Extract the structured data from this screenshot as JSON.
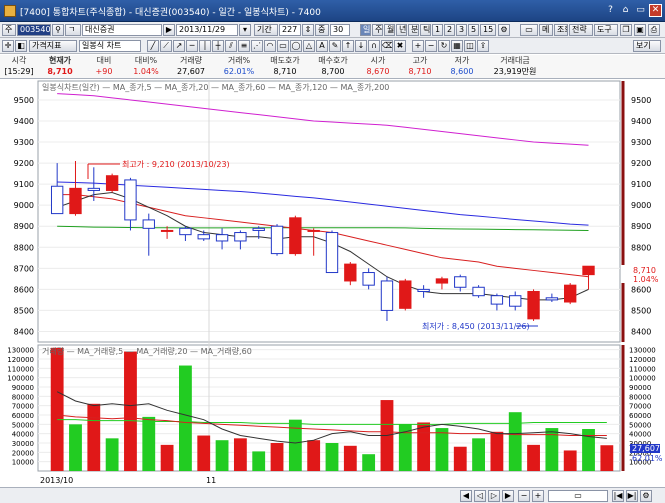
{
  "window": {
    "title": "[7400] 통합차트(주식종합) - 대신증권(003540) - 일간 - 일봉식차트) - 7400",
    "buttons": [
      "?",
      "⌂",
      "▭",
      "✕"
    ]
  },
  "toolbar1": {
    "code_prefix": "주",
    "stock_code": "003540",
    "market_box": "ㄱ",
    "stock_name": "대신증권",
    "date": "2013/11/29",
    "period_label": "기간",
    "period_value": "227",
    "zoom_label": "중",
    "zoom_value": "30",
    "periods": [
      "일",
      "주",
      "월",
      "년",
      "분",
      "틱",
      "1",
      "2",
      "3",
      "5",
      "15"
    ],
    "right_buttons": [
      "메",
      "조회",
      "전략",
      "도구"
    ]
  },
  "toolbar2": {
    "left_buttons": [
      "가격지표",
      "일봉식 차트"
    ],
    "view_button": "보기"
  },
  "info": {
    "headers": [
      "시각",
      "현재가",
      "대비",
      "대비%",
      "거래량",
      "거래%",
      "매도호가",
      "매수호가",
      "시가",
      "고가",
      "저가",
      "거래대금"
    ],
    "values": [
      "[15:29]",
      "8,710",
      "+90",
      "1.04%",
      "27,607",
      "62.01%",
      "8,710",
      "8,700",
      "8,670",
      "8,710",
      "8,600",
      "23,919만원"
    ]
  },
  "price_legend": "일봉식차트(일간) — MA_종가,5 — MA_종가,20 — MA_종가,60 — MA_종가,120 — MA_종가,200",
  "volume_legend": "거래량 — MA_거래량,5 — MA_거래량,20 — MA_거래량,60",
  "annotations": {
    "high": "최고가 : 9,210 (2013/10/23)",
    "low": "최저가 : 8,450 (2013/11/26)"
  },
  "current_tag": {
    "price": "8,710",
    "pct": "1.04%"
  },
  "volume_tag": {
    "vol": "27,607",
    "pct": "62.01%"
  },
  "x_labels": [
    "2013/10",
    "11"
  ],
  "colors": {
    "up": "#e01818",
    "down": "#2238c8",
    "ma5": "#333333",
    "ma20": "#d82020",
    "ma60": "#2a2ae0",
    "ma120": "#20a020",
    "ma200": "#d020d0",
    "volume_green": "#22cc22"
  },
  "chart_data": {
    "type": "candlestick",
    "title": "",
    "price_ylim": [
      8350,
      9590
    ],
    "price_ticks": [
      8400,
      8500,
      8600,
      8700,
      8800,
      8900,
      9000,
      9100,
      9200,
      9300,
      9400,
      9500
    ],
    "volume_ylim": [
      0,
      135000
    ],
    "volume_ticks": [
      10000,
      20000,
      30000,
      40000,
      50000,
      60000,
      70000,
      80000,
      90000,
      100000,
      110000,
      120000,
      130000
    ],
    "candles": [
      {
        "o": 9090,
        "h": 9200,
        "l": 8960,
        "c": 8960
      },
      {
        "o": 8960,
        "h": 9210,
        "l": 8950,
        "c": 9080
      },
      {
        "o": 9080,
        "h": 9180,
        "l": 9020,
        "c": 9070
      },
      {
        "o": 9070,
        "h": 9150,
        "l": 9060,
        "c": 9140
      },
      {
        "o": 9120,
        "h": 9130,
        "l": 8880,
        "c": 8930
      },
      {
        "o": 8930,
        "h": 8960,
        "l": 8760,
        "c": 8890
      },
      {
        "o": 8880,
        "h": 8900,
        "l": 8840,
        "c": 8880
      },
      {
        "o": 8890,
        "h": 8900,
        "l": 8830,
        "c": 8860
      },
      {
        "o": 8860,
        "h": 8880,
        "l": 8830,
        "c": 8840
      },
      {
        "o": 8860,
        "h": 8890,
        "l": 8790,
        "c": 8830
      },
      {
        "o": 8870,
        "h": 8880,
        "l": 8790,
        "c": 8830
      },
      {
        "o": 8890,
        "h": 8900,
        "l": 8840,
        "c": 8880
      },
      {
        "o": 8900,
        "h": 8910,
        "l": 8760,
        "c": 8770
      },
      {
        "o": 8770,
        "h": 8950,
        "l": 8760,
        "c": 8940
      },
      {
        "o": 8880,
        "h": 8890,
        "l": 8760,
        "c": 8880
      },
      {
        "o": 8870,
        "h": 8880,
        "l": 8680,
        "c": 8680
      },
      {
        "o": 8640,
        "h": 8730,
        "l": 8620,
        "c": 8720
      },
      {
        "o": 8680,
        "h": 8700,
        "l": 8600,
        "c": 8620
      },
      {
        "o": 8640,
        "h": 8660,
        "l": 8450,
        "c": 8500
      },
      {
        "o": 8510,
        "h": 8650,
        "l": 8500,
        "c": 8640
      },
      {
        "o": 8600,
        "h": 8620,
        "l": 8560,
        "c": 8590
      },
      {
        "o": 8630,
        "h": 8660,
        "l": 8600,
        "c": 8650
      },
      {
        "o": 8660,
        "h": 8670,
        "l": 8590,
        "c": 8610
      },
      {
        "o": 8610,
        "h": 8620,
        "l": 8560,
        "c": 8570
      },
      {
        "o": 8570,
        "h": 8580,
        "l": 8500,
        "c": 8530
      },
      {
        "o": 8570,
        "h": 8590,
        "l": 8500,
        "c": 8520
      },
      {
        "o": 8460,
        "h": 8600,
        "l": 8450,
        "c": 8590
      },
      {
        "o": 8560,
        "h": 8580,
        "l": 8540,
        "c": 8550
      },
      {
        "o": 8540,
        "h": 8630,
        "l": 8530,
        "c": 8620
      },
      {
        "o": 8670,
        "h": 8710,
        "l": 8600,
        "c": 8710
      }
    ],
    "ma5": [
      8990,
      9020,
      9050,
      9060,
      9030,
      8990,
      8950,
      8900,
      8870,
      8860,
      8850,
      8850,
      8840,
      8850,
      8850,
      8820,
      8780,
      8720,
      8660,
      8620,
      8590,
      8580,
      8580,
      8580,
      8570,
      8560,
      8550,
      8550,
      8560,
      8600
    ],
    "ma20": [
      9050,
      9050,
      9040,
      9030,
      9010,
      8990,
      8970,
      8950,
      8940,
      8930,
      8920,
      8910,
      8900,
      8890,
      8880,
      8870,
      8850,
      8830,
      8810,
      8790,
      8770,
      8750,
      8740,
      8730,
      8710,
      8700,
      8690,
      8680,
      8670,
      8660
    ],
    "ma60": [
      9110,
      9108,
      9105,
      9100,
      9095,
      9090,
      9085,
      9080,
      9075,
      9070,
      9065,
      9058,
      9050,
      9042,
      9035,
      9025,
      9015,
      9005,
      8995,
      8985,
      8975,
      8965,
      8955,
      8948,
      8940,
      8932,
      8925,
      8918,
      8910,
      8905
    ],
    "ma120": [
      8900,
      8898,
      8896,
      8895,
      8894,
      8893,
      8893,
      8892,
      8892,
      8892,
      8893,
      8893,
      8893,
      8893,
      8893,
      8893,
      8893,
      8893,
      8893,
      8892,
      8890,
      8888,
      8887,
      8886,
      8885,
      8884,
      8883,
      8882,
      8881,
      8880
    ],
    "ma200": [
      9530,
      9525,
      9520,
      9510,
      9500,
      9490,
      9480,
      9470,
      9460,
      9450,
      9440,
      9430,
      9420,
      9410,
      9400,
      9395,
      9390,
      9385,
      9380,
      9370,
      9360,
      9350,
      9340,
      9330,
      9320,
      9310,
      9300,
      9295,
      9290,
      9285
    ],
    "volume": [
      132000,
      50000,
      72000,
      35000,
      128000,
      58000,
      28000,
      113000,
      38000,
      33000,
      35000,
      21000,
      30000,
      55000,
      33000,
      30000,
      27000,
      18000,
      76000,
      50000,
      52000,
      46000,
      26000,
      35000,
      42000,
      63000,
      28000,
      46000,
      22000,
      45000,
      27607
    ],
    "vol_ma5": [
      85000,
      75000,
      70000,
      72000,
      70000,
      72000,
      65000,
      60000,
      55000,
      45000,
      38000,
      35000,
      32000,
      30000,
      33000,
      40000,
      42000,
      38000,
      38000,
      42000,
      47000,
      50000,
      48000,
      45000,
      40000,
      40000,
      41000,
      42000,
      40000,
      37000,
      35000
    ],
    "vol_ma20": [
      60000,
      58000,
      57000,
      56000,
      57000,
      55000,
      54000,
      52000,
      51000,
      50000,
      49000,
      48000,
      47000,
      46000,
      45000,
      44000,
      43000,
      42000,
      42000,
      41000,
      41000,
      41000,
      40000,
      40000,
      40000,
      39000,
      39000,
      39000,
      38000,
      38000,
      38000
    ],
    "vol_ma60": [
      55000,
      55000,
      54000,
      54000,
      54000,
      53000,
      53000,
      53000,
      52000,
      52000,
      52000,
      51000,
      51000,
      51000,
      50000,
      50000,
      50000,
      50000,
      50000,
      50000,
      50000,
      50000,
      51000,
      51000,
      51000,
      51000,
      52000,
      52000,
      52000,
      52000,
      52000
    ]
  }
}
